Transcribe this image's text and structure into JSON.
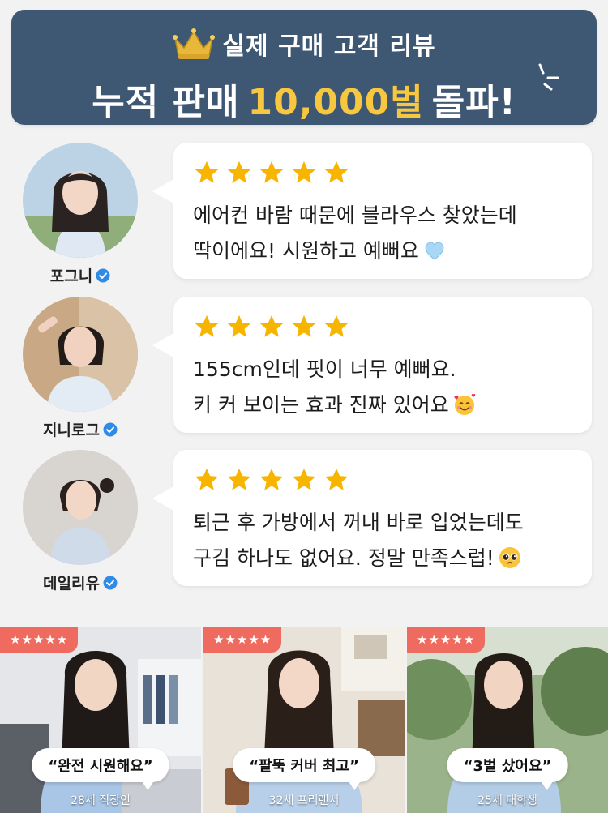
{
  "header": {
    "subtitle": "실제 구매 고객 리뷰",
    "headline_prefix": "누적 판매",
    "headline_accent": "10,000벌",
    "headline_suffix": "돌파!",
    "colors": {
      "background": "#3e5773",
      "accent": "#f7c740"
    }
  },
  "reviews": [
    {
      "username": "포그니",
      "rating": 5,
      "lines": [
        "에어컨 바람 때문에 블라우스 찾았는데",
        "딱이에요! 시원하고 예뻐요"
      ],
      "emoji": "light-blue-heart"
    },
    {
      "username": "지니로그",
      "rating": 5,
      "lines": [
        "155cm인데 핏이 너무 예뻐요.",
        "키 커 보이는 효과 진짜 있어요"
      ],
      "emoji": "smiling-face-with-hearts"
    },
    {
      "username": "데일리유",
      "rating": 5,
      "lines": [
        "퇴근 후 가방에서 꺼내 바로 입었는데도",
        "구김 하나도 없어요. 정말 만족스럽!"
      ],
      "emoji": "pleading-face"
    }
  ],
  "photos": [
    {
      "rating_label": "★★★★★",
      "quote": "“완전 시원해요”",
      "caption": "28세 직장인"
    },
    {
      "rating_label": "★★★★★",
      "quote": "“팔뚝 커버 최고”",
      "caption": "32세 프리랜서"
    },
    {
      "rating_label": "★★★★★",
      "quote": "“3벌 샀어요”",
      "caption": "25세 대학생"
    }
  ],
  "colors": {
    "star": "#f7b500",
    "verified": "#2f8be6",
    "badge": "#ef6b5f"
  }
}
